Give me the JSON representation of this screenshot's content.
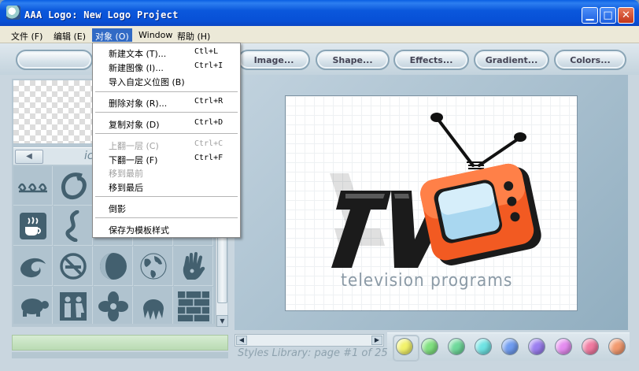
{
  "window": {
    "title": "AAA Logo: New Logo Project",
    "minimize_symbol": "▁",
    "maximize_symbol": "□",
    "close_symbol": "✕"
  },
  "menubar": {
    "items": [
      "文件 (F)",
      "编辑 (E)",
      "对象 (O)",
      "Window",
      "帮助 (H)"
    ],
    "active_index": 2
  },
  "toolbar": {
    "buttons": [
      "Image...",
      "Shape...",
      "Effects...",
      "Gradient...",
      "Colors..."
    ]
  },
  "object_menu": {
    "items": [
      {
        "label": "新建文本 (T)...",
        "shortcut": "Ctl+L",
        "enabled": true
      },
      {
        "label": "新建图像 (I)...",
        "shortcut": "Ctrl+I",
        "enabled": true
      },
      {
        "label": "导入自定义位图 (B)",
        "shortcut": "",
        "enabled": true
      },
      {
        "label": "删除对象 (R)...",
        "shortcut": "Ctrl+R",
        "enabled": true
      },
      {
        "label": "复制对象 (D)",
        "shortcut": "Ctrl+D",
        "enabled": true
      },
      {
        "label": "上翻一层 (C)",
        "shortcut": "Ctrl+C",
        "enabled": false
      },
      {
        "label": "下翻一层 (F)",
        "shortcut": "Ctrl+F",
        "enabled": true
      },
      {
        "label": "移到最前",
        "shortcut": "",
        "enabled": false
      },
      {
        "label": "移到最后",
        "shortcut": "",
        "enabled": true
      },
      {
        "label": "倒影",
        "shortcut": "",
        "enabled": true
      },
      {
        "label": "保存为模板样式",
        "shortcut": "",
        "enabled": true
      }
    ]
  },
  "icons_panel": {
    "tab_label": "ico",
    "icons": [
      "swirls-icon",
      "circle-swoosh-icon",
      "swirl-icon",
      "coffee-cup-icon",
      "s-curve-icon",
      "wave-curl-icon",
      "no-smoking-icon",
      "globe-icon",
      "hand-icon",
      "turtle-icon",
      "people-icon",
      "flower-icon",
      "jellyfish-icon",
      "brick-wall-icon"
    ]
  },
  "logo": {
    "text": "TV",
    "subtitle": "television programs"
  },
  "styles_library": {
    "text": "Styles Library: page #1 of 25"
  },
  "swatches": [
    "#f2f26a",
    "#7fe07f",
    "#6fd99b",
    "#6ee3e3",
    "#6f9cf0",
    "#9b7ff0",
    "#e58cf0",
    "#f07aa0",
    "#f29a6f"
  ]
}
